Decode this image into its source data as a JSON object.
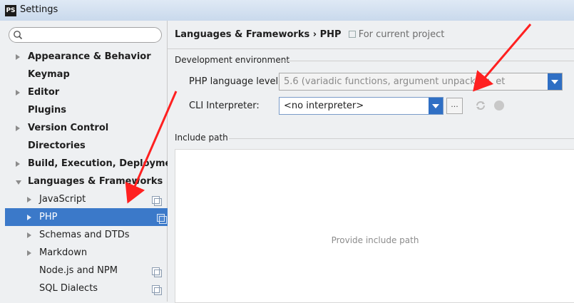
{
  "window": {
    "title": "Settings",
    "app_icon_text": "PS"
  },
  "search": {
    "placeholder": "",
    "icon": "search-icon"
  },
  "tree": {
    "items": [
      {
        "label": "Appearance & Behavior",
        "bold": true,
        "arrow": "right",
        "copy": false
      },
      {
        "label": "Keymap",
        "bold": true,
        "arrow": "none",
        "copy": false
      },
      {
        "label": "Editor",
        "bold": true,
        "arrow": "right",
        "copy": false
      },
      {
        "label": "Plugins",
        "bold": true,
        "arrow": "none",
        "copy": false
      },
      {
        "label": "Version Control",
        "bold": true,
        "arrow": "right",
        "copy": false
      },
      {
        "label": "Directories",
        "bold": true,
        "arrow": "none",
        "copy": false
      },
      {
        "label": "Build, Execution, Deployment",
        "bold": true,
        "arrow": "right",
        "copy": false
      },
      {
        "label": "Languages & Frameworks",
        "bold": true,
        "arrow": "down",
        "copy": false
      },
      {
        "label": "JavaScript",
        "bold": false,
        "arrow": "right",
        "copy": true
      },
      {
        "label": "PHP",
        "bold": false,
        "arrow": "right",
        "copy": true,
        "selected": true
      },
      {
        "label": "Schemas and DTDs",
        "bold": false,
        "arrow": "right",
        "copy": false
      },
      {
        "label": "Markdown",
        "bold": false,
        "arrow": "right",
        "copy": false
      },
      {
        "label": "Node.js and NPM",
        "bold": false,
        "arrow": "none",
        "copy": true
      },
      {
        "label": "SQL Dialects",
        "bold": false,
        "arrow": "none",
        "copy": true
      }
    ]
  },
  "header": {
    "breadcrumb": "Languages & Frameworks › PHP",
    "scope": "For current project"
  },
  "dev_env": {
    "group_label": "Development environment",
    "php_level_label": "PHP language level:",
    "php_level_value": "5.6 (variadic functions, argument unpacking, et",
    "cli_label": "CLI Interpreter:",
    "cli_value": "<no interpreter>",
    "browse_label": "..."
  },
  "include": {
    "group_label": "Include path",
    "empty_text": "Provide include path"
  },
  "colors": {
    "selection": "#3b79c9",
    "combo_button": "#2f6fc4",
    "annotation_arrow": "#ff2020"
  }
}
